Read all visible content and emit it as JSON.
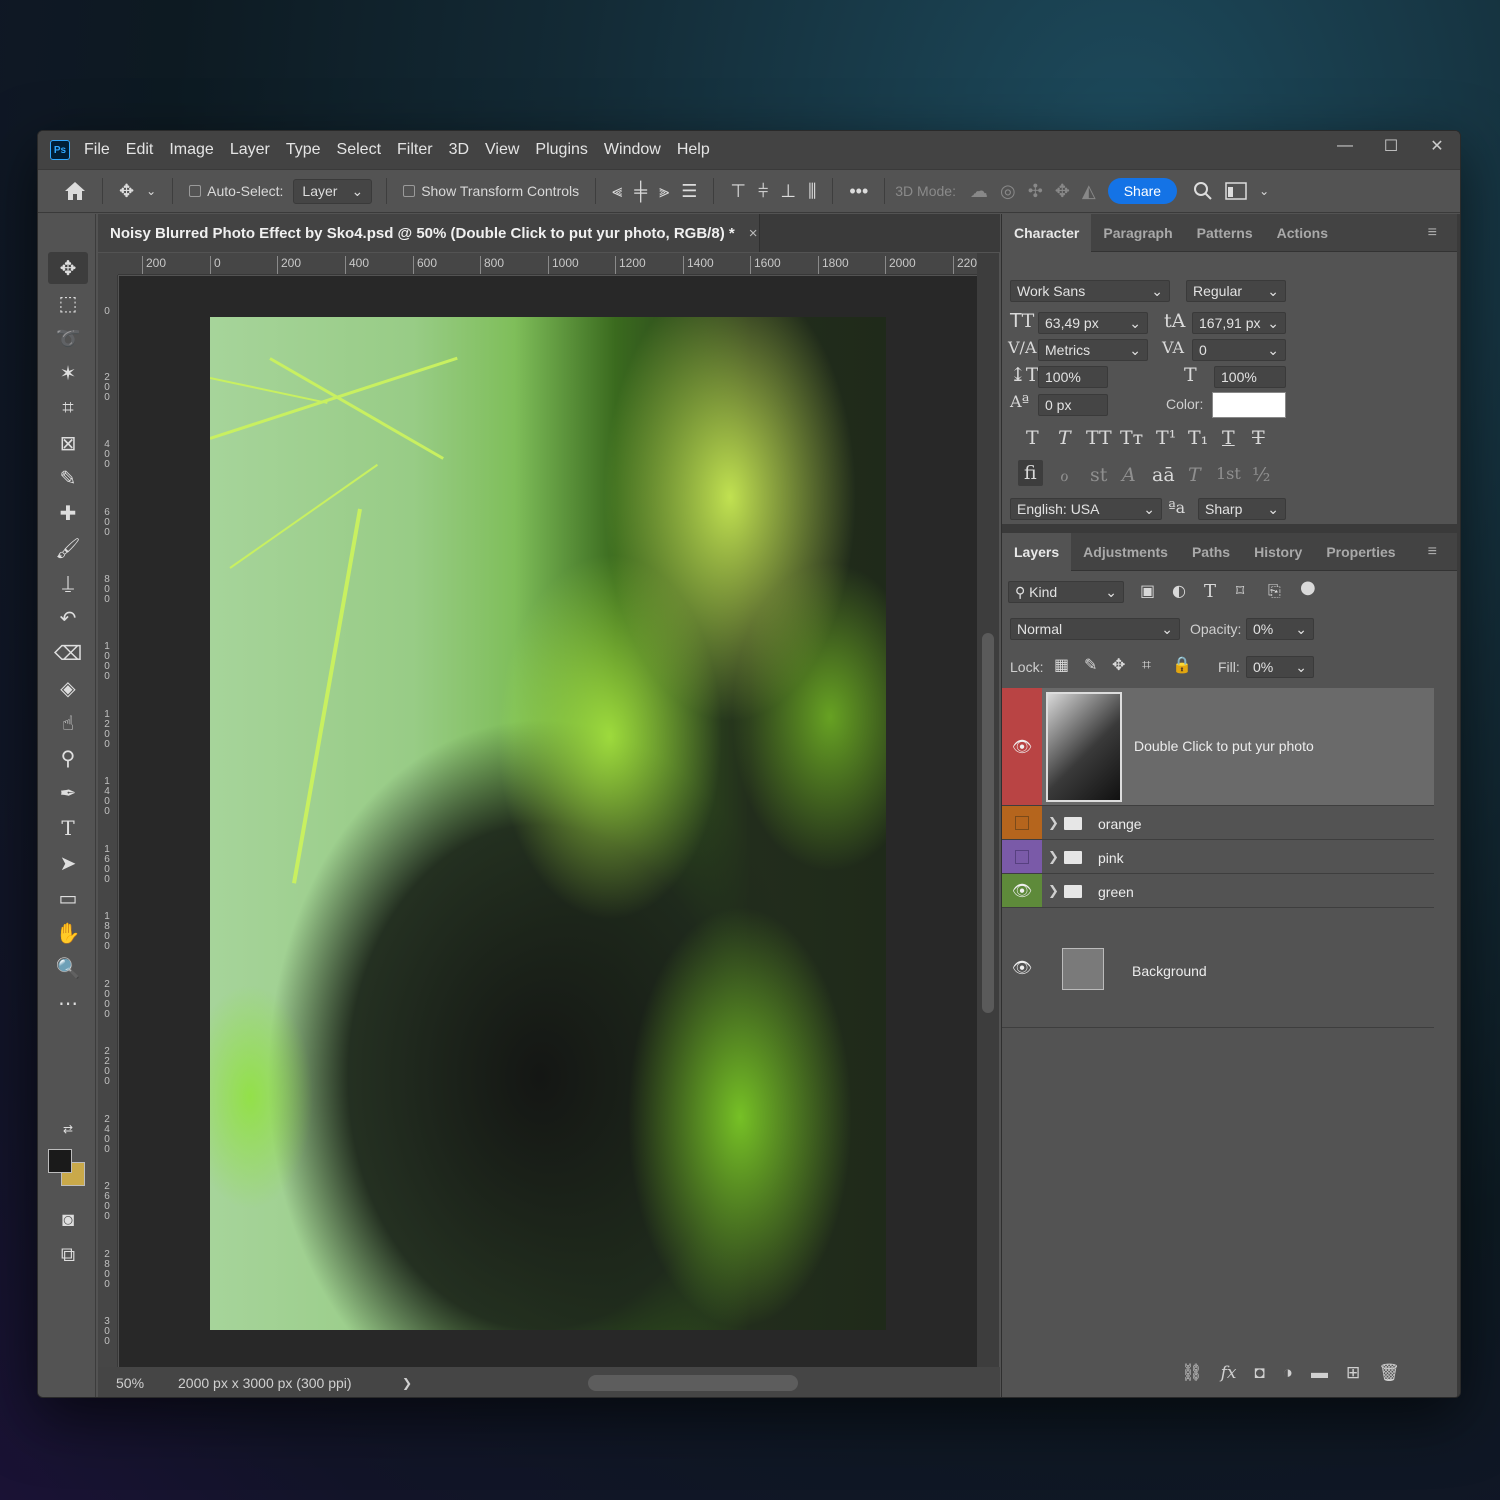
{
  "app": {
    "logo": "Ps",
    "menus": [
      "File",
      "Edit",
      "Image",
      "Layer",
      "Type",
      "Select",
      "Filter",
      "3D",
      "View",
      "Plugins",
      "Window",
      "Help"
    ]
  },
  "window_controls": {
    "minimize": "—",
    "maximize": "☐",
    "close": "✕"
  },
  "options_bar": {
    "auto_select_label": "Auto-Select:",
    "auto_select_value": "Layer",
    "transform_label": "Show Transform Controls",
    "mode_3d_label": "3D Mode:",
    "share_label": "Share",
    "more_label": "•••"
  },
  "document": {
    "tab_title": "Noisy Blurred Photo Effect by Sko4.psd @ 50% (Double Click to put yur photo, RGB/8) *",
    "close": "×",
    "zoom": "50%",
    "info": "2000 px x 3000 px (300 ppi)",
    "info_arrow": "❯"
  },
  "rulers": {
    "horizontal": [
      "200",
      "0",
      "200",
      "400",
      "600",
      "800",
      "1000",
      "1200",
      "1400",
      "1600",
      "1800",
      "2000",
      "220"
    ],
    "vertical": [
      "0",
      "200",
      "400",
      "600",
      "800",
      "1000",
      "1200",
      "1400",
      "1600",
      "1800",
      "2000",
      "2200",
      "2400",
      "2600",
      "2800",
      "300"
    ]
  },
  "character_panel": {
    "tabs": [
      "Character",
      "Paragraph",
      "Patterns",
      "Actions"
    ],
    "font_family": "Work Sans",
    "font_style": "Regular",
    "font_size": "63,49 px",
    "leading": "167,91 px",
    "kerning": "Metrics",
    "tracking": "0",
    "vertical_scale": "100%",
    "horizontal_scale": "100%",
    "baseline_shift": "0 px",
    "color_label": "Color:",
    "color_value": "#ffffff",
    "type_styles": [
      "T",
      "T",
      "TT",
      "Tт",
      "T¹",
      "T₁",
      "T",
      "T"
    ],
    "opentype": [
      "fi",
      "ℴ",
      "st",
      "A",
      "aā",
      "T",
      "1st",
      "½"
    ],
    "language": "English: USA",
    "aa_icon": "ªa",
    "antialias": "Sharp"
  },
  "layers_panel": {
    "tabs": [
      "Layers",
      "Adjustments",
      "Paths",
      "History",
      "Properties"
    ],
    "filter_kind": "Kind",
    "blend_mode": "Normal",
    "opacity_label": "Opacity:",
    "opacity": "0%",
    "lock_label": "Lock:",
    "fill_label": "Fill:",
    "fill": "0%",
    "layers": [
      {
        "name": "Double Click to put yur photo",
        "visible": true,
        "color": "#b94444",
        "type": "smart-object",
        "selected": true
      },
      {
        "name": "orange",
        "visible": false,
        "color": "#b5651d",
        "type": "group"
      },
      {
        "name": "pink",
        "visible": false,
        "color": "#7a5aa8",
        "type": "group"
      },
      {
        "name": "green",
        "visible": true,
        "color": "#5e8a3a",
        "type": "group"
      },
      {
        "name": "Background",
        "visible": true,
        "color": "",
        "type": "background"
      }
    ]
  },
  "colors": {
    "accent": "#1473e6",
    "foreground": "#1a1a1a",
    "background": "#c9a94a"
  }
}
